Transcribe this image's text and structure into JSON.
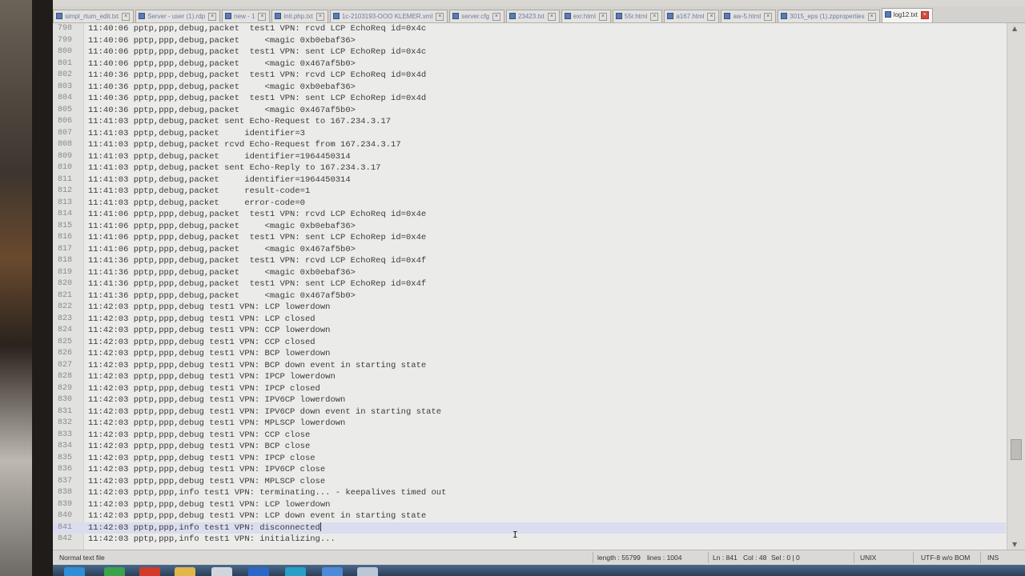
{
  "tabs": [
    {
      "label": "simpl_rtum_edit.txt",
      "active": false
    },
    {
      "label": "Server - user (1).rdp",
      "active": false
    },
    {
      "label": "new - 1",
      "active": false
    },
    {
      "label": "init.php.txt",
      "active": false
    },
    {
      "label": "1c-2103193-OOO KLEMER.xml",
      "active": false
    },
    {
      "label": "server.cfg",
      "active": false
    },
    {
      "label": "23423.txt",
      "active": false
    },
    {
      "label": "exr.html",
      "active": false
    },
    {
      "label": "55r.html",
      "active": false
    },
    {
      "label": "a167.html",
      "active": false
    },
    {
      "label": "aw-5.html",
      "active": false
    },
    {
      "label": "3015_eps (1).zpproperties",
      "active": false
    },
    {
      "label": "log12.txt",
      "active": true
    }
  ],
  "editor": {
    "current_line": "841",
    "lines": [
      {
        "n": "798",
        "t": "11:40:06 pptp,ppp,debug,packet  test1 VPN: rcvd LCP EchoReq id=0x4c"
      },
      {
        "n": "799",
        "t": "11:40:06 pptp,ppp,debug,packet     <magic 0xb0ebaf36>"
      },
      {
        "n": "800",
        "t": "11:40:06 pptp,ppp,debug,packet  test1 VPN: sent LCP EchoRep id=0x4c"
      },
      {
        "n": "801",
        "t": "11:40:06 pptp,ppp,debug,packet     <magic 0x467af5b0>"
      },
      {
        "n": "802",
        "t": "11:40:36 pptp,ppp,debug,packet  test1 VPN: rcvd LCP EchoReq id=0x4d"
      },
      {
        "n": "803",
        "t": "11:40:36 pptp,ppp,debug,packet     <magic 0xb0ebaf36>"
      },
      {
        "n": "804",
        "t": "11:40:36 pptp,ppp,debug,packet  test1 VPN: sent LCP EchoRep id=0x4d"
      },
      {
        "n": "805",
        "t": "11:40:36 pptp,ppp,debug,packet     <magic 0x467af5b0>"
      },
      {
        "n": "806",
        "t": "11:41:03 pptp,debug,packet sent Echo-Request to 167.234.3.17"
      },
      {
        "n": "807",
        "t": "11:41:03 pptp,debug,packet     identifier=3"
      },
      {
        "n": "808",
        "t": "11:41:03 pptp,debug,packet rcvd Echo-Request from 167.234.3.17"
      },
      {
        "n": "809",
        "t": "11:41:03 pptp,debug,packet     identifier=1964450314"
      },
      {
        "n": "810",
        "t": "11:41:03 pptp,debug,packet sent Echo-Reply to 167.234.3.17"
      },
      {
        "n": "811",
        "t": "11:41:03 pptp,debug,packet     identifier=1964450314"
      },
      {
        "n": "812",
        "t": "11:41:03 pptp,debug,packet     result-code=1"
      },
      {
        "n": "813",
        "t": "11:41:03 pptp,debug,packet     error-code=0"
      },
      {
        "n": "814",
        "t": "11:41:06 pptp,ppp,debug,packet  test1 VPN: rcvd LCP EchoReq id=0x4e"
      },
      {
        "n": "815",
        "t": "11:41:06 pptp,ppp,debug,packet     <magic 0xb0ebaf36>"
      },
      {
        "n": "816",
        "t": "11:41:06 pptp,ppp,debug,packet  test1 VPN: sent LCP EchoRep id=0x4e"
      },
      {
        "n": "817",
        "t": "11:41:06 pptp,ppp,debug,packet     <magic 0x467af5b0>"
      },
      {
        "n": "818",
        "t": "11:41:36 pptp,ppp,debug,packet  test1 VPN: rcvd LCP EchoReq id=0x4f"
      },
      {
        "n": "819",
        "t": "11:41:36 pptp,ppp,debug,packet     <magic 0xb0ebaf36>"
      },
      {
        "n": "820",
        "t": "11:41:36 pptp,ppp,debug,packet  test1 VPN: sent LCP EchoRep id=0x4f"
      },
      {
        "n": "821",
        "t": "11:41:36 pptp,ppp,debug,packet     <magic 0x467af5b0>"
      },
      {
        "n": "822",
        "t": "11:42:03 pptp,ppp,debug test1 VPN: LCP lowerdown"
      },
      {
        "n": "823",
        "t": "11:42:03 pptp,ppp,debug test1 VPN: LCP closed"
      },
      {
        "n": "824",
        "t": "11:42:03 pptp,ppp,debug test1 VPN: CCP lowerdown"
      },
      {
        "n": "825",
        "t": "11:42:03 pptp,ppp,debug test1 VPN: CCP closed"
      },
      {
        "n": "826",
        "t": "11:42:03 pptp,ppp,debug test1 VPN: BCP lowerdown"
      },
      {
        "n": "827",
        "t": "11:42:03 pptp,ppp,debug test1 VPN: BCP down event in starting state"
      },
      {
        "n": "828",
        "t": "11:42:03 pptp,ppp,debug test1 VPN: IPCP lowerdown"
      },
      {
        "n": "829",
        "t": "11:42:03 pptp,ppp,debug test1 VPN: IPCP closed"
      },
      {
        "n": "830",
        "t": "11:42:03 pptp,ppp,debug test1 VPN: IPV6CP lowerdown"
      },
      {
        "n": "831",
        "t": "11:42:03 pptp,ppp,debug test1 VPN: IPV6CP down event in starting state"
      },
      {
        "n": "832",
        "t": "11:42:03 pptp,ppp,debug test1 VPN: MPLSCP lowerdown"
      },
      {
        "n": "833",
        "t": "11:42:03 pptp,ppp,debug test1 VPN: CCP close"
      },
      {
        "n": "834",
        "t": "11:42:03 pptp,ppp,debug test1 VPN: BCP close"
      },
      {
        "n": "835",
        "t": "11:42:03 pptp,ppp,debug test1 VPN: IPCP close"
      },
      {
        "n": "836",
        "t": "11:42:03 pptp,ppp,debug test1 VPN: IPV6CP close"
      },
      {
        "n": "837",
        "t": "11:42:03 pptp,ppp,debug test1 VPN: MPLSCP close"
      },
      {
        "n": "838",
        "t": "11:42:03 pptp,ppp,info test1 VPN: terminating... - keepalives timed out"
      },
      {
        "n": "839",
        "t": "11:42:03 pptp,ppp,debug test1 VPN: LCP lowerdown"
      },
      {
        "n": "840",
        "t": "11:42:03 pptp,ppp,debug test1 VPN: LCP down event in starting state"
      },
      {
        "n": "841",
        "t": "11:42:03 pptp,ppp,info test1 VPN: disconnected"
      },
      {
        "n": "842",
        "t": "11:42:03 pptp,ppp,info test1 VPN: initializing..."
      }
    ]
  },
  "status": {
    "file_type": "Normal text file",
    "length": "length : 55799",
    "lines": "lines : 1004",
    "ln": "Ln : 841",
    "col": "Col : 48",
    "sel": "Sel : 0 | 0",
    "eol": "UNIX",
    "encoding": "UTF-8 w/o BOM",
    "mode": "INS"
  },
  "colors": {
    "accent_active_tab_close": "#d24a3c",
    "current_line": "#dcdcf0",
    "taskbar": "#3a5472"
  }
}
